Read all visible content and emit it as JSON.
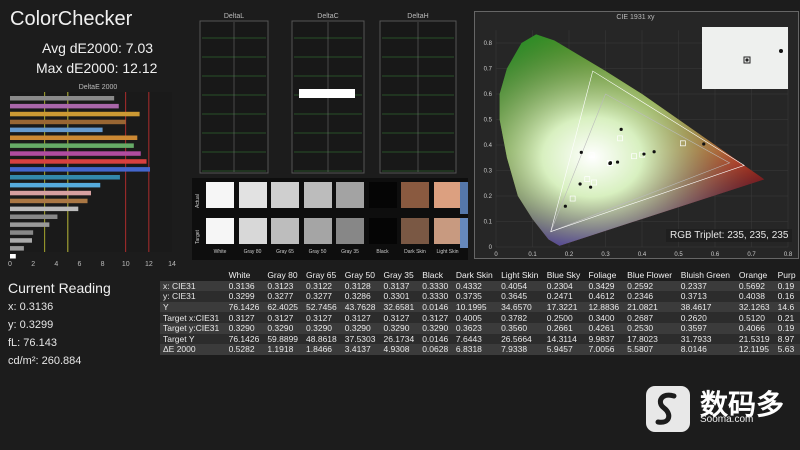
{
  "app": {
    "title": "ColorChecker"
  },
  "summary": {
    "avg_de": "Avg dE2000: 7.03",
    "max_de": "Max dE2000: 12.12"
  },
  "current": {
    "title": "Current Reading",
    "x": "x: 0.3136",
    "y": "y: 0.3299",
    "fL": "fL: 76.143",
    "cdm2": "cd/m²: 260.884"
  },
  "charts": {
    "de_title": "DeltaE 2000",
    "de_ticks": [
      "0",
      "2",
      "4",
      "6",
      "8",
      "10",
      "12",
      "14"
    ],
    "deltaL_title": "DeltaL",
    "deltaC_title": "DeltaC",
    "deltaH_title": "DeltaH",
    "cie_title": "CIE 1931 xy",
    "cie_xticks": [
      "0",
      "0.1",
      "0.2",
      "0.3",
      "0.4",
      "0.5",
      "0.6",
      "0.7",
      "0.8"
    ],
    "cie_yticks": [
      "0",
      "0.1",
      "0.2",
      "0.3",
      "0.4",
      "0.5",
      "0.6",
      "0.7",
      "0.8"
    ],
    "rgb_triplet": "RGB Triplet: 235, 235, 235"
  },
  "chart_data": [
    {
      "type": "bar",
      "title": "DeltaE 2000",
      "orientation": "horizontal",
      "xlim": [
        0,
        14
      ],
      "reference_lines": [
        {
          "value": 3,
          "color": "#c8c832"
        },
        {
          "value": 5,
          "color": "#e0e040"
        },
        {
          "value": 10,
          "color": "#d03030"
        },
        {
          "value": 12,
          "color": "#d03030"
        }
      ],
      "bars": [
        {
          "value": 9.0,
          "color": "#8a8a8a"
        },
        {
          "value": 9.4,
          "color": "#aa66aa"
        },
        {
          "value": 11.2,
          "color": "#cc9933"
        },
        {
          "value": 10.0,
          "color": "#996633"
        },
        {
          "value": 8.0,
          "color": "#6699cc"
        },
        {
          "value": 11.0,
          "color": "#cc8833"
        },
        {
          "value": 10.7,
          "color": "#66aa66"
        },
        {
          "value": 11.3,
          "color": "#b04ca0"
        },
        {
          "value": 11.8,
          "color": "#d84040"
        },
        {
          "value": 12.1,
          "color": "#4466cc"
        },
        {
          "value": 9.5,
          "color": "#3388aa"
        },
        {
          "value": 7.8,
          "color": "#55aadd"
        },
        {
          "value": 7.0,
          "color": "#d7a0a0"
        },
        {
          "value": 6.7,
          "color": "#aa7744"
        },
        {
          "value": 5.9,
          "color": "#bbbbbb"
        },
        {
          "value": 4.1,
          "color": "#888888"
        },
        {
          "value": 3.4,
          "color": "#999999"
        },
        {
          "value": 2.0,
          "color": "#888888"
        },
        {
          "value": 1.9,
          "color": "#aaaaaa"
        },
        {
          "value": 1.2,
          "color": "#999999"
        },
        {
          "value": 0.5,
          "color": "#ffffff"
        }
      ]
    },
    {
      "type": "bar",
      "title": "DeltaC",
      "bars": [
        {
          "value": 1.0,
          "color": "#ffffff"
        }
      ]
    },
    {
      "type": "scatter",
      "title": "CIE 1931 xy",
      "xlim": [
        0,
        0.8
      ],
      "ylim": [
        0,
        0.85
      ],
      "gamut_target": [
        [
          0.64,
          0.33
        ],
        [
          0.3,
          0.6
        ],
        [
          0.15,
          0.06
        ]
      ],
      "gamut_measured": [
        [
          0.68,
          0.32
        ],
        [
          0.265,
          0.69
        ],
        [
          0.15,
          0.06
        ]
      ]
    }
  ],
  "patches": {
    "actual_label": "Actual",
    "target_label": "Target",
    "items": [
      {
        "label": "White",
        "actual": "#f6f6f6",
        "target": "#f6f6f6"
      },
      {
        "label": "Gray 80",
        "actual": "#e2e2e2",
        "target": "#d8d8d8"
      },
      {
        "label": "Gray 65",
        "actual": "#cfcfcf",
        "target": "#bdbdbd"
      },
      {
        "label": "Gray 50",
        "actual": "#bcbcbc",
        "target": "#a5a5a5"
      },
      {
        "label": "Gray 35",
        "actual": "#a3a3a3",
        "target": "#878787"
      },
      {
        "label": "Black",
        "actual": "#050505",
        "target": "#050505"
      },
      {
        "label": "Dark Skin",
        "actual": "#8a5a40",
        "target": "#7a5844"
      },
      {
        "label": "Light Skin",
        "actual": "#dca080",
        "target": "#c89a80"
      }
    ]
  },
  "table": {
    "columns": [
      "",
      "White",
      "Gray 80",
      "Gray 65",
      "Gray 50",
      "Gray 35",
      "Black",
      "Dark Skin",
      "Light Skin",
      "Blue Sky",
      "Foliage",
      "Blue Flower",
      "Bluish Green",
      "Orange",
      "Purp"
    ],
    "rows": [
      [
        "x: CIE31",
        "0.3136",
        "0.3123",
        "0.3122",
        "0.3128",
        "0.3137",
        "0.3330",
        "0.4332",
        "0.4054",
        "0.2304",
        "0.3429",
        "0.2592",
        "0.2337",
        "0.5692",
        "0.19"
      ],
      [
        "y: CIE31",
        "0.3299",
        "0.3277",
        "0.3277",
        "0.3286",
        "0.3301",
        "0.3330",
        "0.3735",
        "0.3645",
        "0.2471",
        "0.4612",
        "0.2346",
        "0.3713",
        "0.4038",
        "0.16"
      ],
      [
        "Y",
        "76.1426",
        "62.4025",
        "52.7456",
        "43.7628",
        "32.6581",
        "0.0146",
        "10.1995",
        "34.6570",
        "17.3221",
        "12.8836",
        "21.0821",
        "38.4617",
        "32.1263",
        "14.6"
      ],
      [
        "Target x:CIE31",
        "0.3127",
        "0.3127",
        "0.3127",
        "0.3127",
        "0.3127",
        "0.3127",
        "0.4005",
        "0.3782",
        "0.2500",
        "0.3400",
        "0.2687",
        "0.2620",
        "0.5120",
        "0.21"
      ],
      [
        "Target y:CIE31",
        "0.3290",
        "0.3290",
        "0.3290",
        "0.3290",
        "0.3290",
        "0.3290",
        "0.3623",
        "0.3560",
        "0.2661",
        "0.4261",
        "0.2530",
        "0.3597",
        "0.4066",
        "0.19"
      ],
      [
        "Target Y",
        "76.1426",
        "59.8899",
        "48.8618",
        "37.5303",
        "26.1734",
        "0.0146",
        "7.6443",
        "26.5664",
        "14.3114",
        "9.9837",
        "17.8023",
        "31.7933",
        "21.5319",
        "8.97"
      ],
      [
        "ΔE 2000",
        "0.5282",
        "1.1918",
        "1.8466",
        "3.4137",
        "4.9308",
        "0.0628",
        "6.8318",
        "7.9338",
        "5.9457",
        "7.0056",
        "5.5807",
        "8.0146",
        "12.1195",
        "5.63"
      ]
    ]
  },
  "watermark": {
    "cn": "数码多",
    "en": "Sooma.com"
  },
  "colors": {
    "background": "#1c1c1c",
    "panel": "#262626",
    "grid_green": "#3a8a3a"
  }
}
